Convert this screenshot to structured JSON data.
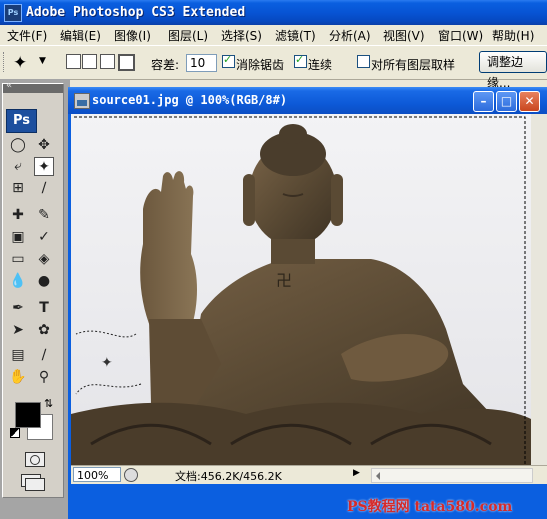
{
  "app": {
    "badge": "Ps",
    "title": "Adobe Photoshop CS3 Extended"
  },
  "menu": [
    "文件(F)",
    "编辑(E)",
    "图像(I)",
    "图层(L)",
    "选择(S)",
    "滤镜(T)",
    "分析(A)",
    "视图(V)",
    "窗口(W)",
    "帮助(H)"
  ],
  "options": {
    "tool_icon": "magic-wand-icon",
    "tolerance_label": "容差:",
    "tolerance_value": "10",
    "antialias_label": "消除锯齿",
    "antialias_checked": true,
    "contiguous_label": "连续",
    "contiguous_checked": true,
    "sample_all_label": "对所有图层取样",
    "sample_all_checked": false,
    "refine_edge_label": "调整边缘..."
  },
  "toolbox": {
    "logo": "Ps",
    "active_tool": "magic-wand-icon",
    "foreground_color": "#000000",
    "background_color": "#ffffff"
  },
  "document": {
    "title": "source01.jpg @ 100%(RGB/8#)",
    "zoom": "100%",
    "doc_info": "文档:456.2K/456.2K"
  },
  "watermark": "PS教程网 tata580.com"
}
